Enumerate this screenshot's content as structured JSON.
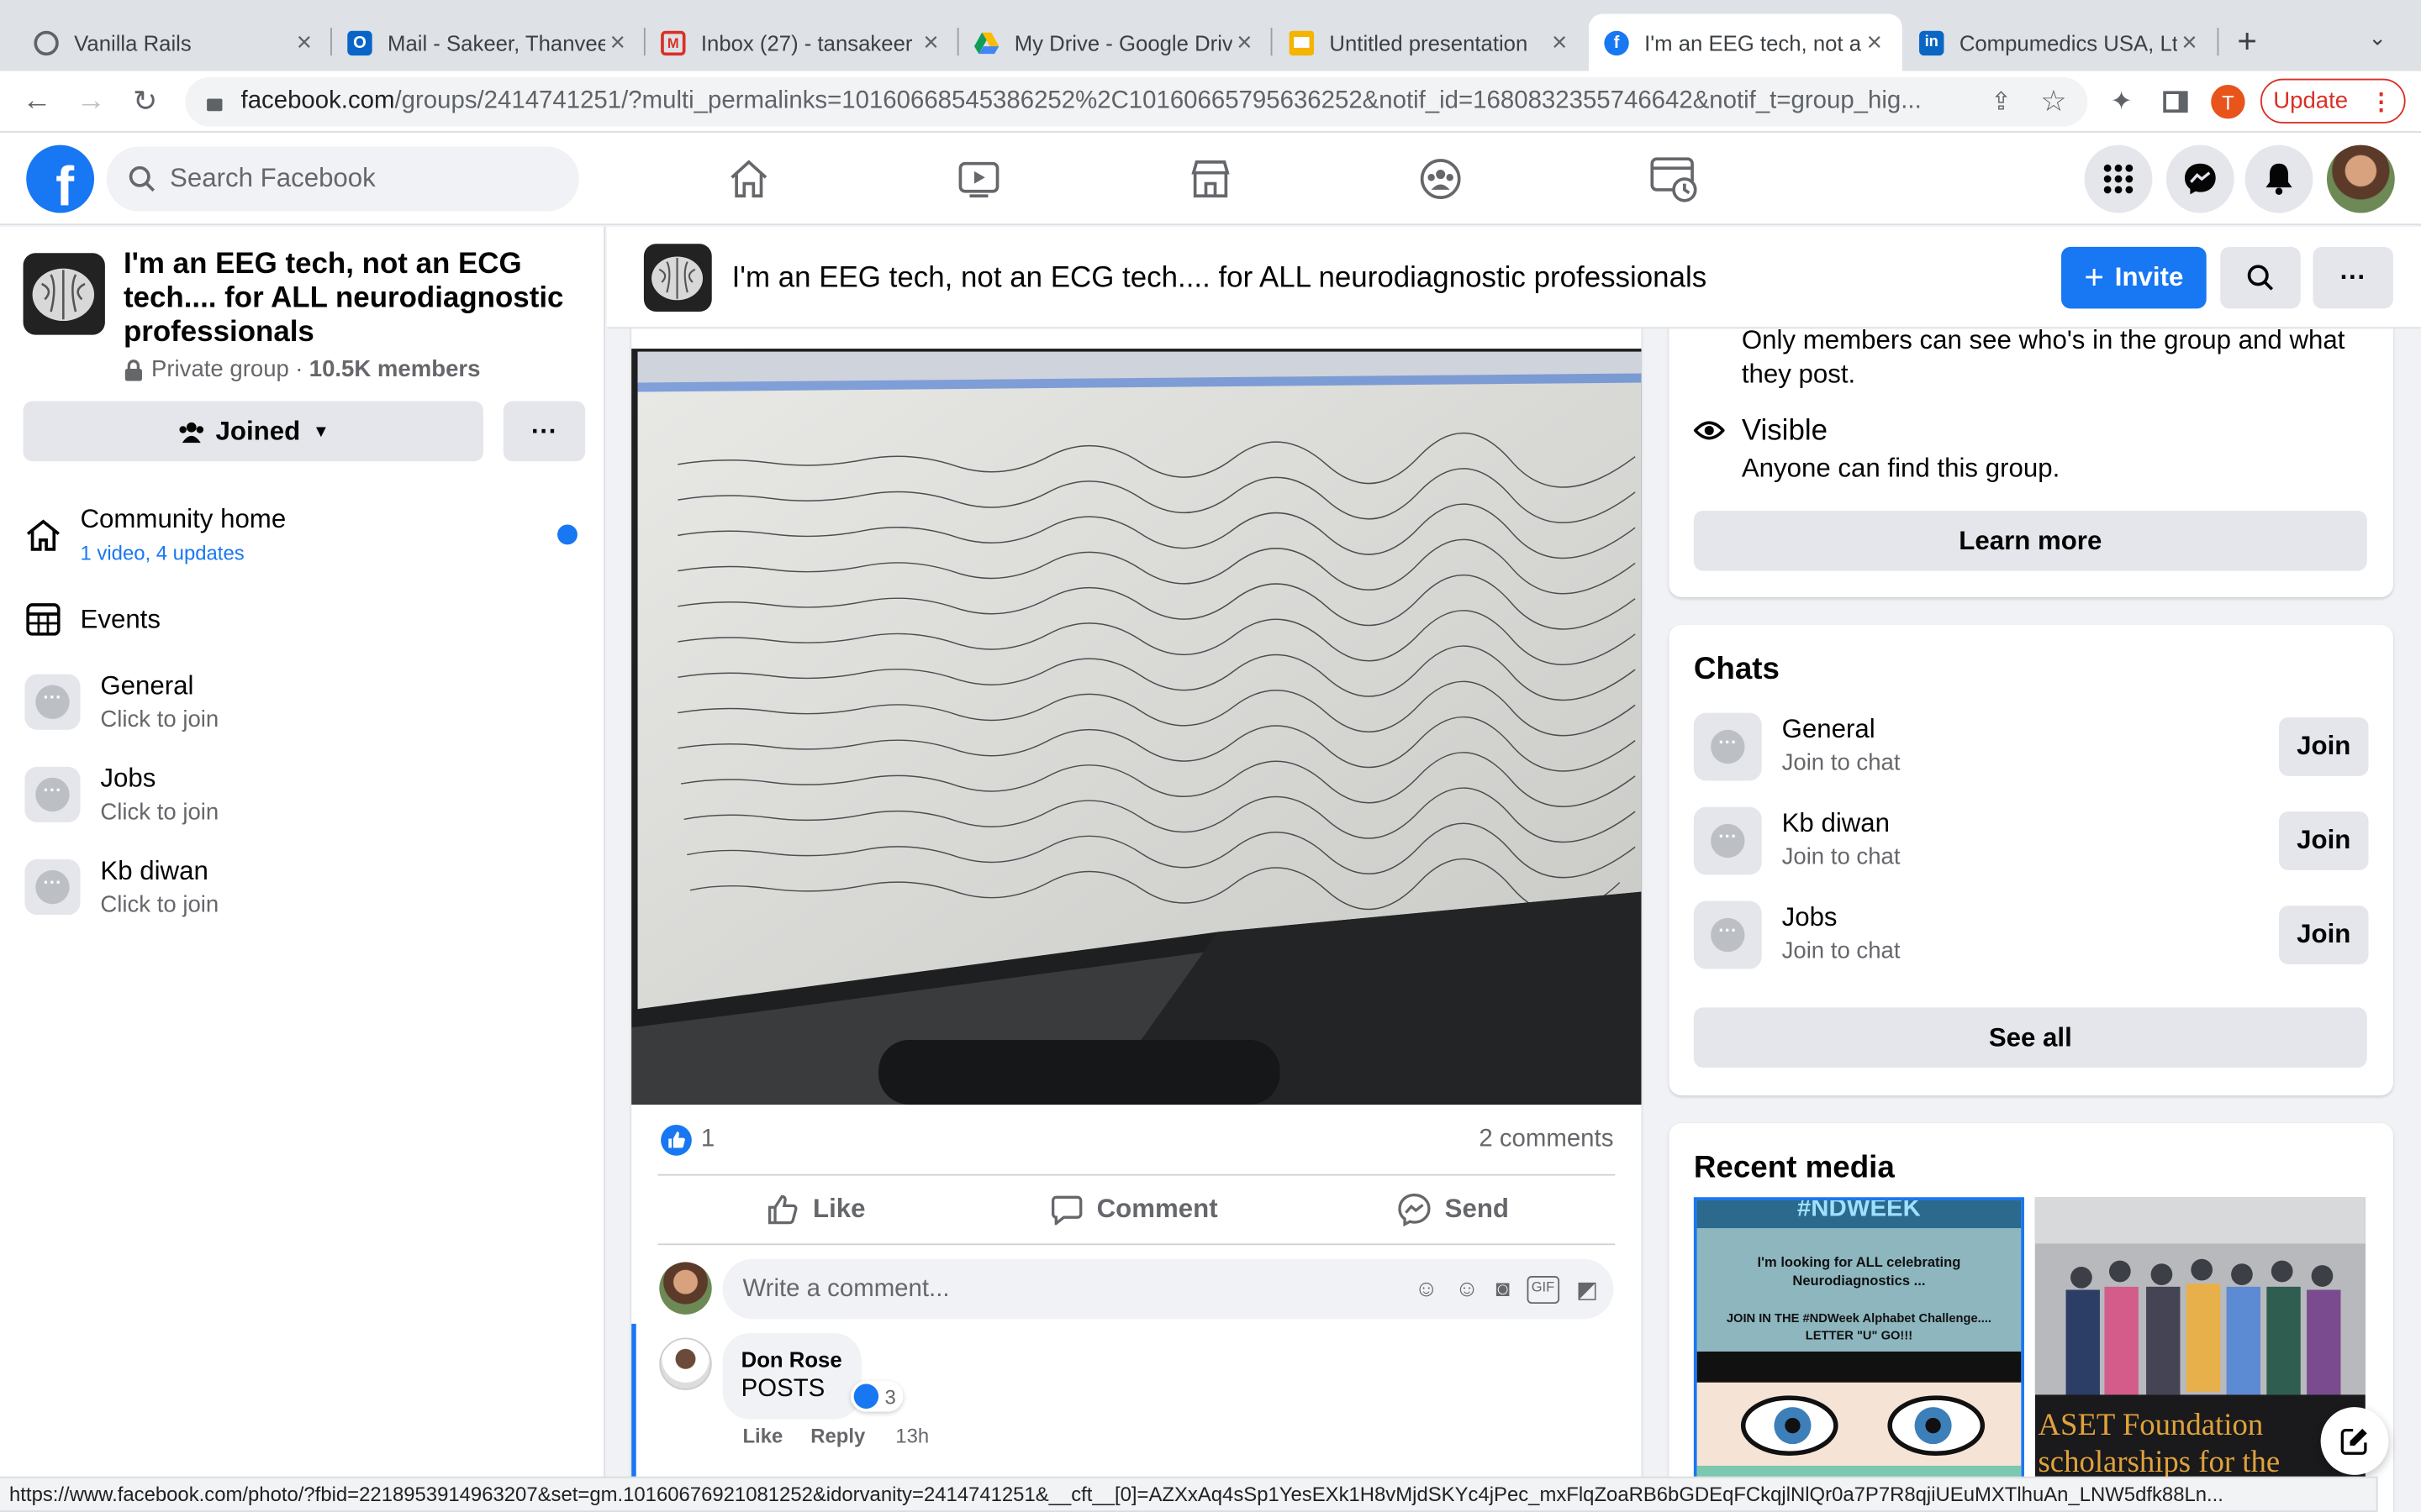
{
  "browser": {
    "tabs": [
      {
        "title": "Vanilla Rails",
        "icon": "globe-icon"
      },
      {
        "title": "Mail - Sakeer, Thanveer",
        "icon": "outlook-icon"
      },
      {
        "title": "Inbox (27) - tansakeer",
        "icon": "gmail-icon"
      },
      {
        "title": "My Drive - Google Drive",
        "icon": "drive-icon"
      },
      {
        "title": "Untitled presentation",
        "icon": "slides-icon"
      },
      {
        "title": "I'm an EEG tech, not an ECG",
        "icon": "facebook-icon",
        "active": true
      },
      {
        "title": "Compumedics USA, Ltd",
        "icon": "linkedin-icon"
      }
    ],
    "url_host": "facebook.com",
    "url_path": "/groups/2414741251/?multi_permalinks=10160668545386252%2C10160665795636252&notif_id=1680832355746642&notif_t=group_hig...",
    "profile_initial": "T",
    "update_label": "Update",
    "status_url": "https://www.facebook.com/photo/?fbid=2218953914963207&set=gm.10160676921081252&idorvanity=2414741251&__cft__[0]=AZXxAq4sSp1YesEXk1H8vMjdSKYc4jPec_mxFlqZoaRB6bGDEqFCkqjlNlQr0a7P7R8qjiUEuMXTlhuAn_LNW5dfk88Ln..."
  },
  "header": {
    "search_placeholder": "Search Facebook"
  },
  "group": {
    "name": "I'm an EEG tech, not an ECG tech.... for ALL neurodiagnostic professionals",
    "privacy": "Private group",
    "members": "10.5K members",
    "joined_label": "Joined",
    "more_label": "···",
    "nav": [
      {
        "label": "Community home",
        "sub": "1 video, 4 updates"
      },
      {
        "label": "Events"
      }
    ],
    "chats": [
      {
        "name": "General",
        "sub": "Click to join"
      },
      {
        "name": "Jobs",
        "sub": "Click to join"
      },
      {
        "name": "Kb diwan",
        "sub": "Click to join"
      }
    ],
    "invite_label": "Invite"
  },
  "post": {
    "reaction_count": "1",
    "comments_count": "2 comments",
    "actions": [
      "Like",
      "Comment",
      "Send"
    ],
    "comment_placeholder": "Write a comment...",
    "comment": {
      "author": "Don Rose",
      "text": "POSTS",
      "reactions": "3",
      "like": "Like",
      "reply": "Reply",
      "time": "13h"
    }
  },
  "about": {
    "members_text": "Only members can see who's in the group and what they post.",
    "visible_title": "Visible",
    "visible_text": "Anyone can find this group.",
    "learn_more": "Learn more"
  },
  "chats_card": {
    "title": "Chats",
    "items": [
      {
        "name": "General",
        "sub": "Join to chat",
        "btn": "Join"
      },
      {
        "name": "Kb diwan",
        "sub": "Join to chat",
        "btn": "Join"
      },
      {
        "name": "Jobs",
        "sub": "Join to chat",
        "btn": "Join"
      }
    ],
    "see_all": "See all"
  },
  "recent_media": {
    "title": "Recent media",
    "img1_lines": [
      "#NDWEEK",
      "I'm looking for ALL celebrating Neurodiagnostics ...",
      "JOIN IN THE #NDWeek Alphabet Challenge....",
      "LETTER \"U\" GO!!!"
    ],
    "img2_caption": "ASET Foundation scholarships for the"
  },
  "colors": {
    "fb_blue": "#1877f2",
    "bg": "#f0f2f5"
  }
}
